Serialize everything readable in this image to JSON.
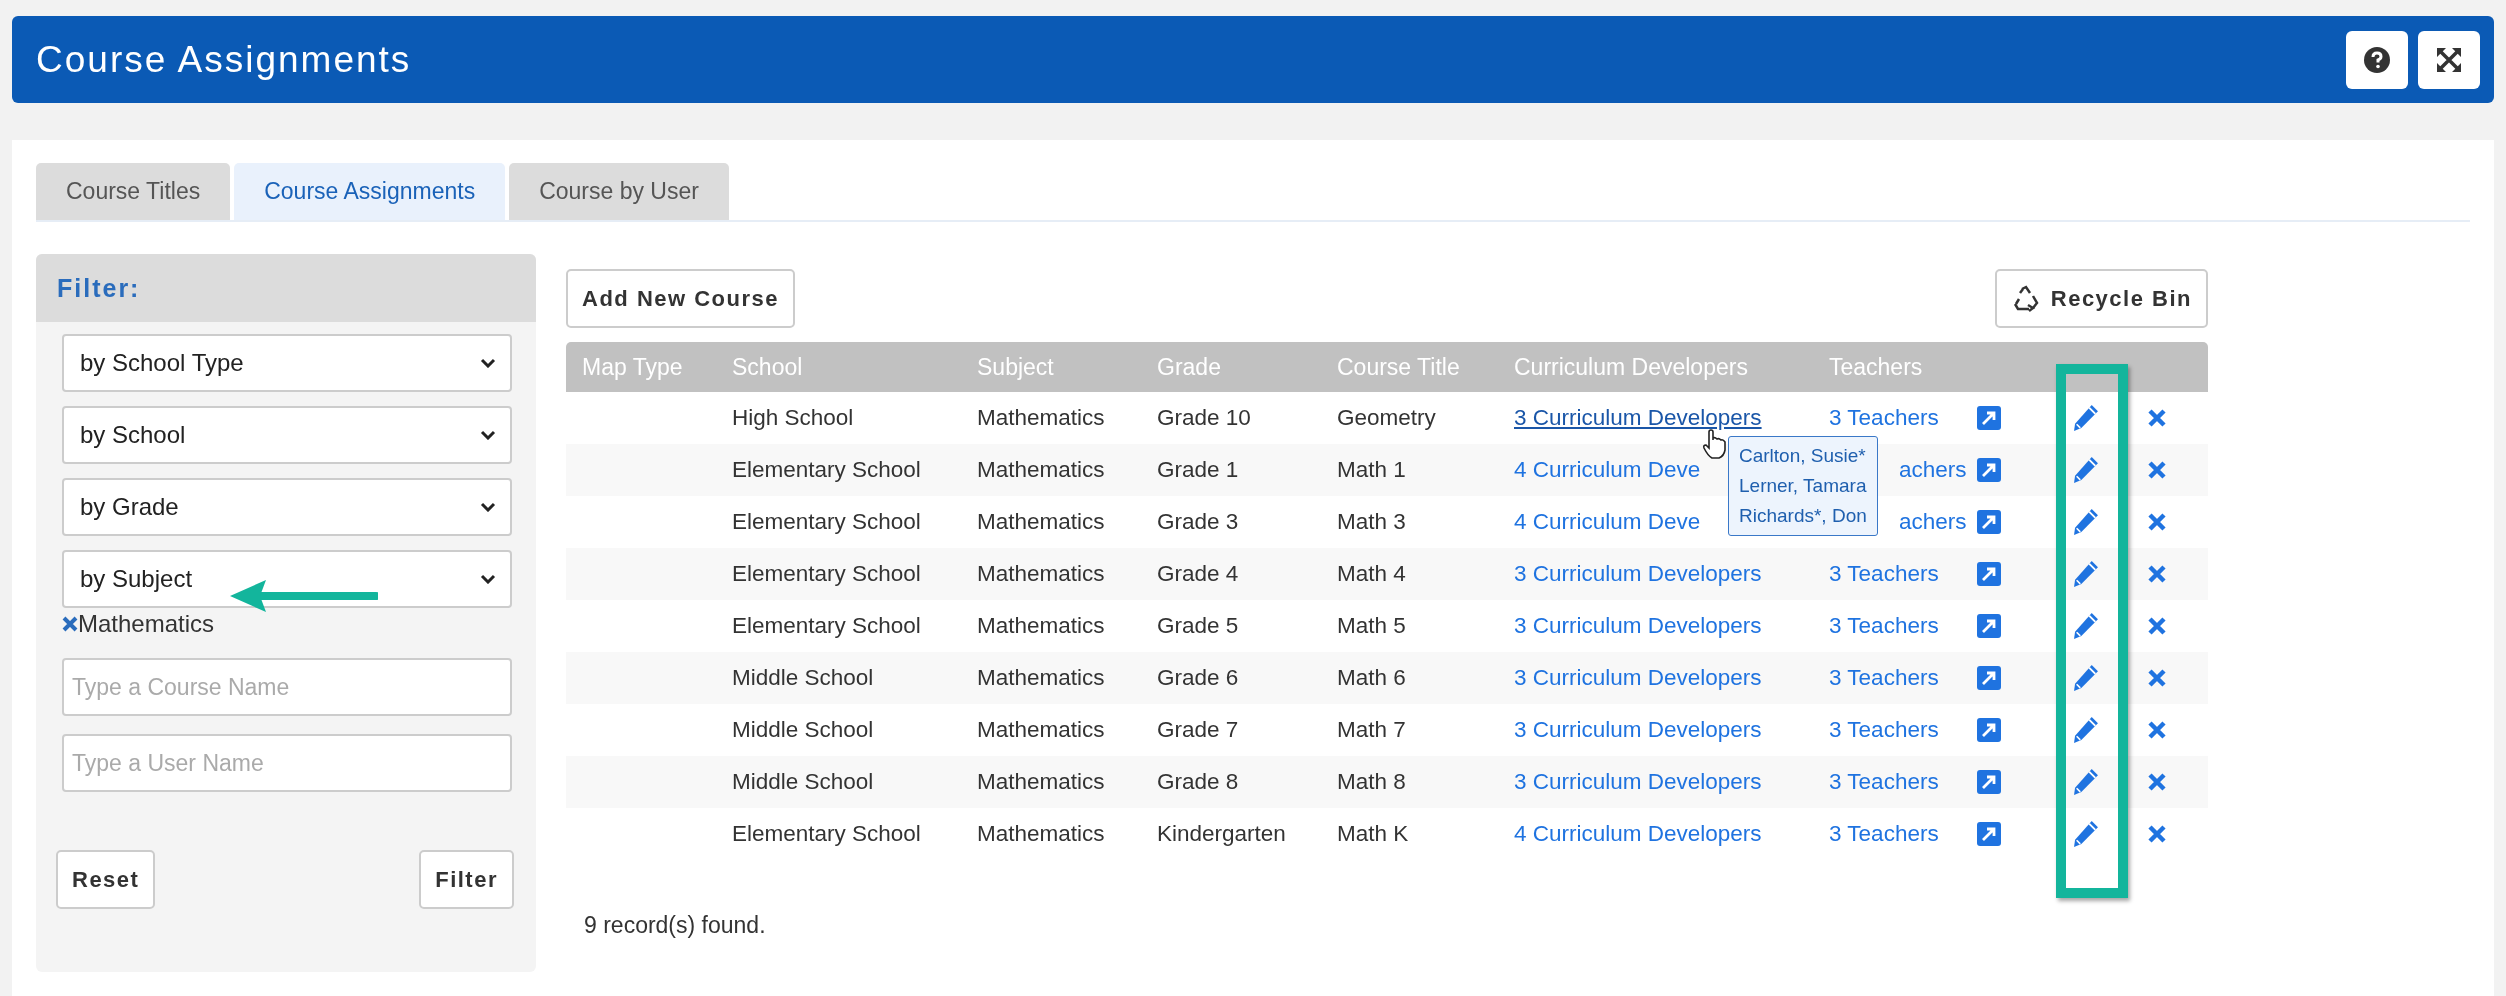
{
  "header": {
    "title": "Course Assignments"
  },
  "tabs": [
    {
      "label": "Course Titles",
      "selected": false
    },
    {
      "label": "Course Assignments",
      "selected": true
    },
    {
      "label": "Course by User",
      "selected": false
    }
  ],
  "filter": {
    "title": "Filter:",
    "selects": [
      "by School Type",
      "by School",
      "by Grade",
      "by Subject"
    ],
    "chips": [
      "Mathematics"
    ],
    "inputs": [
      {
        "placeholder": "Type a Course Name"
      },
      {
        "placeholder": "Type a User Name"
      }
    ],
    "buttons": [
      "Reset",
      "Filter"
    ]
  },
  "toolbar": {
    "add_button": "Add New Course",
    "recycle_button": "Recycle Bin"
  },
  "table": {
    "columns": [
      "Map Type",
      "School",
      "Subject",
      "Grade",
      "Course Title",
      "Curriculum Developers",
      "Teachers"
    ],
    "rows": [
      {
        "school": "High School",
        "subject": "Mathematics",
        "grade": "Grade 10",
        "course_title": "Geometry",
        "developers": "3 Curriculum Developers",
        "teachers": "3 Teachers",
        "hovered": true,
        "covered": false
      },
      {
        "school": "Elementary School",
        "subject": "Mathematics",
        "grade": "Grade 1",
        "course_title": "Math 1",
        "developers": "4 Curriculum Deve",
        "teachers": "achers",
        "hovered": false,
        "covered": true
      },
      {
        "school": "Elementary School",
        "subject": "Mathematics",
        "grade": "Grade 3",
        "course_title": "Math 3",
        "developers": "4 Curriculum Deve",
        "teachers": "achers",
        "hovered": false,
        "covered": true
      },
      {
        "school": "Elementary School",
        "subject": "Mathematics",
        "grade": "Grade 4",
        "course_title": "Math 4",
        "developers": "3 Curriculum Developers",
        "teachers": "3 Teachers",
        "hovered": false,
        "covered": false
      },
      {
        "school": "Elementary School",
        "subject": "Mathematics",
        "grade": "Grade 5",
        "course_title": "Math 5",
        "developers": "3 Curriculum Developers",
        "teachers": "3 Teachers",
        "hovered": false,
        "covered": false
      },
      {
        "school": "Middle School",
        "subject": "Mathematics",
        "grade": "Grade 6",
        "course_title": "Math 6",
        "developers": "3 Curriculum Developers",
        "teachers": "3 Teachers",
        "hovered": false,
        "covered": false
      },
      {
        "school": "Middle School",
        "subject": "Mathematics",
        "grade": "Grade 7",
        "course_title": "Math 7",
        "developers": "3 Curriculum Developers",
        "teachers": "3 Teachers",
        "hovered": false,
        "covered": false
      },
      {
        "school": "Middle School",
        "subject": "Mathematics",
        "grade": "Grade 8",
        "course_title": "Math 8",
        "developers": "3 Curriculum Developers",
        "teachers": "3 Teachers",
        "hovered": false,
        "covered": false
      },
      {
        "school": "Elementary School",
        "subject": "Mathematics",
        "grade": "Kindergarten",
        "course_title": "Math K",
        "developers": "4 Curriculum Developers",
        "teachers": "3 Teachers",
        "hovered": false,
        "covered": false
      }
    ]
  },
  "tooltip": {
    "lines": [
      "Carlton, Susie*",
      "Lerner, Tamara",
      "Richards*, Don"
    ]
  },
  "status": "9 record(s) found.",
  "annotations": {
    "arrow": true,
    "highlight": true
  }
}
